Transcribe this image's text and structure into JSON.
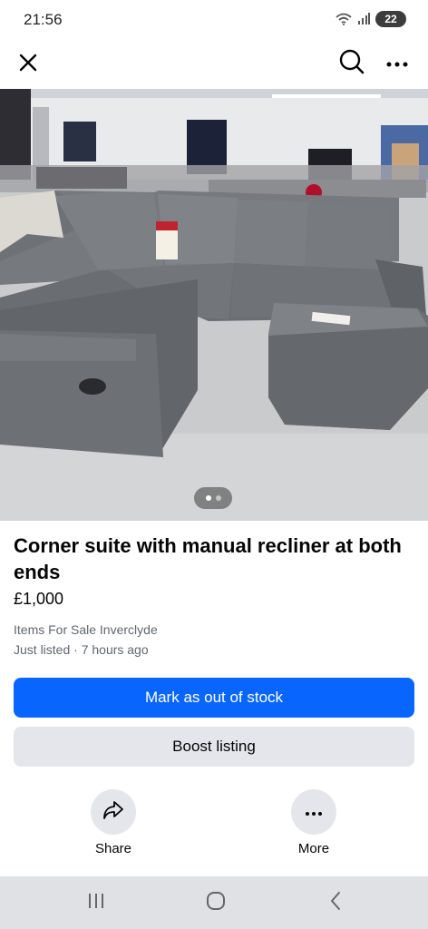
{
  "status_bar": {
    "time": "21:56",
    "battery": "22",
    "icons": [
      "wifi-icon",
      "signal-icon",
      "battery-charging-icon"
    ]
  },
  "app_bar": {
    "icons": [
      "close-icon",
      "search-icon",
      "more-horizontal-icon"
    ]
  },
  "photo": {
    "subject": "listing-photo",
    "carousel": {
      "total": 2,
      "active_index": 0
    }
  },
  "listing": {
    "title": "Corner suite with manual recliner at both ends",
    "price": "£1,000",
    "location": "Items For Sale Inverclyde",
    "listed": "Just listed · 7 hours ago"
  },
  "buttons": {
    "mark_out_of_stock": "Mark as out of stock",
    "boost_listing": "Boost listing"
  },
  "actions": {
    "share_label": "Share",
    "more_label": "More"
  },
  "nav_bar": {
    "icons": [
      "recents-icon",
      "home-icon",
      "back-icon"
    ]
  },
  "colors": {
    "primary": "#0866ff",
    "secondary_bg": "#e4e6eb",
    "muted_text": "#606770",
    "nav_bg": "#dfe1e5"
  }
}
